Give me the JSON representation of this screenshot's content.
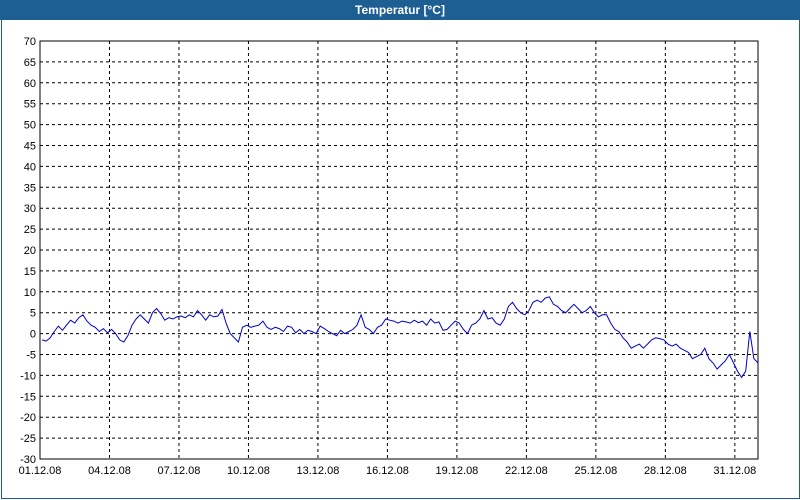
{
  "window": {
    "title": "Temperatur [°C]"
  },
  "colors": {
    "titlebar": "#1d5e93",
    "series": "#0000c8",
    "grid": "#000000",
    "background": "#ffffff"
  },
  "chart_data": {
    "type": "line",
    "title": "Temperatur [°C]",
    "xlabel": "",
    "ylabel": "",
    "ylim": [
      -30,
      70
    ],
    "yticks": [
      70,
      65,
      60,
      55,
      50,
      45,
      40,
      35,
      30,
      25,
      20,
      15,
      10,
      5,
      0,
      -5,
      -10,
      -15,
      -20,
      -25,
      -30
    ],
    "xlim": [
      "01.12.08",
      "01.01.09"
    ],
    "xticks": [
      "01.12.08",
      "04.12.08",
      "07.12.08",
      "10.12.08",
      "13.12.08",
      "16.12.08",
      "19.12.08",
      "22.12.08",
      "25.12.08",
      "28.12.08",
      "31.12.08"
    ],
    "grid": true,
    "legend": "none",
    "series": [
      {
        "values": [
          -1.5,
          -1.8,
          -1.0,
          0.5,
          1.8,
          0.8,
          2.0,
          3.2,
          2.5,
          3.8,
          4.5,
          3.0,
          2.0,
          1.5,
          0.5,
          1.2,
          0.2,
          1.0,
          0.0,
          -1.5,
          -2.0,
          -0.5,
          2.0,
          3.5,
          4.5,
          3.5,
          2.5,
          5.0,
          6.0,
          4.8,
          3.2,
          3.8,
          3.5,
          4.0,
          4.2,
          3.8,
          4.5,
          4.0,
          5.5,
          4.5,
          3.2,
          4.5,
          4.0,
          4.2,
          5.8,
          2.5,
          0.0,
          -1.0,
          -2.0,
          1.5,
          2.0,
          1.5,
          1.8,
          2.0,
          3.0,
          1.5,
          1.0,
          1.5,
          1.2,
          0.5,
          1.8,
          1.5,
          0.2,
          1.0,
          0.0,
          0.8,
          0.5,
          0.0,
          1.8,
          1.2,
          0.5,
          0.0,
          -0.5,
          0.8,
          0.0,
          0.5,
          1.0,
          2.0,
          4.5,
          1.5,
          1.0,
          0.0,
          1.5,
          2.0,
          3.5,
          3.2,
          3.0,
          2.5,
          3.0,
          2.8,
          2.5,
          3.2,
          2.6,
          3.0,
          2.0,
          3.5,
          2.5,
          2.8,
          0.8,
          1.0,
          2.0,
          3.0,
          2.5,
          1.0,
          0.0,
          2.0,
          2.5,
          3.5,
          5.5,
          3.5,
          3.8,
          2.5,
          2.0,
          3.5,
          6.5,
          7.5,
          6.0,
          5.0,
          4.5,
          5.5,
          7.5,
          8.0,
          7.5,
          8.5,
          8.8,
          7.0,
          6.5,
          5.5,
          5.0,
          6.0,
          7.0,
          6.0,
          5.0,
          5.5,
          6.5,
          5.0,
          4.0,
          4.5,
          4.5,
          2.5,
          1.0,
          0.5,
          -1.0,
          -2.0,
          -3.5,
          -3.0,
          -2.5,
          -3.5,
          -2.5,
          -1.5,
          -1.0,
          -1.2,
          -1.5,
          -2.5,
          -3.0,
          -2.5,
          -3.5,
          -4.0,
          -4.5,
          -6.0,
          -5.5,
          -5.0,
          -3.5,
          -6.0,
          -7.0,
          -8.5,
          -7.5,
          -6.5,
          -5.0,
          -7.0,
          -9.0,
          -10.5,
          -9.0,
          0.5,
          -6.0,
          -7.0
        ]
      }
    ]
  }
}
